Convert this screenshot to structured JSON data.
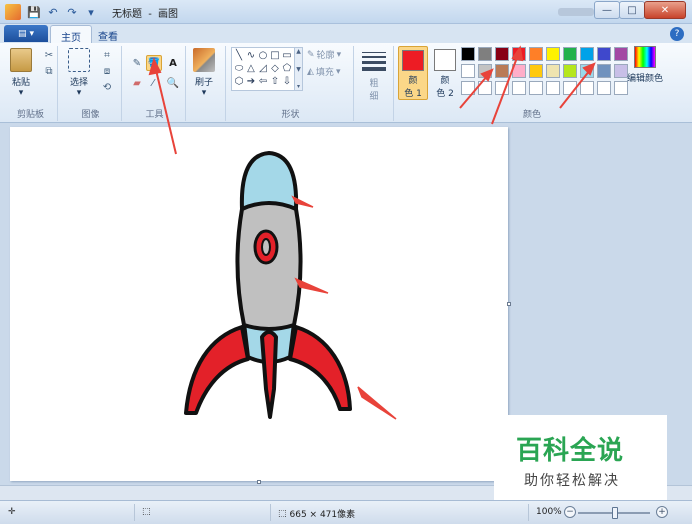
{
  "window": {
    "title_doc": "无标题",
    "title_sep": "-",
    "title_app": "画图",
    "minimize": "—",
    "maximize": "□",
    "close": "✕"
  },
  "qat_icons": [
    "save-icon",
    "undo-icon",
    "redo-icon",
    "customize-icon"
  ],
  "tabs": {
    "file_label": "▾",
    "home": "主页",
    "view": "查看"
  },
  "ribbon": {
    "clipboard": {
      "paste": "粘贴",
      "group": "剪贴板"
    },
    "image": {
      "select": "选择",
      "group": "图像"
    },
    "tools": {
      "text_tool": "A",
      "group": "工具"
    },
    "brushes": {
      "label": "刷子"
    },
    "shapes": {
      "outline": "轮廓",
      "fill": "填充",
      "group": "形状",
      "items": [
        "╲",
        "∿",
        "○",
        "□",
        "▭",
        "⬭",
        "△",
        "◿",
        "◇",
        "⬠",
        "⬡",
        "➔",
        "⇦",
        "⇧",
        "⇩"
      ]
    },
    "size": {
      "line1": "粗",
      "line2": "细"
    },
    "colors": {
      "color1_top": "颜",
      "color1_bottom": "色 1",
      "color2_top": "颜",
      "color2_bottom": "色 2",
      "edit": "编辑颜色",
      "group": "颜色",
      "color1_value": "#ed1c24",
      "color2_value": "#ffffff",
      "palette": [
        "#000000",
        "#7f7f7f",
        "#880015",
        "#ed1c24",
        "#ff7f27",
        "#fff200",
        "#22b14c",
        "#00a2e8",
        "#3f48cc",
        "#a349a4",
        "#ffffff",
        "#c3c3c3",
        "#b97a57",
        "#ffaec9",
        "#ffc90e",
        "#efe4b0",
        "#b5e61d",
        "#99d9ea",
        "#7092be",
        "#c8bfe7",
        "#ffffff",
        "#ffffff",
        "#ffffff",
        "#ffffff",
        "#ffffff",
        "#ffffff",
        "#ffffff",
        "#ffffff",
        "#ffffff",
        "#ffffff"
      ]
    }
  },
  "status": {
    "dimensions": "665 × 471像素",
    "zoom": "100%",
    "zoom_out": "−",
    "zoom_in": "+"
  },
  "watermark": {
    "main": "百科全说",
    "sub": "助你轻松解决"
  },
  "colors": {
    "rocket_body": "#c0c0c0",
    "rocket_nose": "#a4d8e8",
    "rocket_fin": "#e32129",
    "annotation_arrow": "#e8433a"
  }
}
